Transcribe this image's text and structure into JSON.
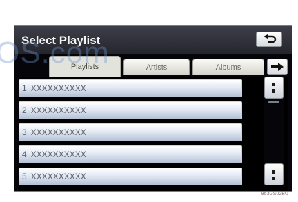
{
  "watermark": "OS.com",
  "header": {
    "title": "Select Playlist",
    "back_icon": "return-arrow-icon"
  },
  "tabs": [
    {
      "label": "Playlists",
      "active": true
    },
    {
      "label": "Artists",
      "active": false
    },
    {
      "label": "Albums",
      "active": false
    }
  ],
  "tab_next_icon": "right-arrow-icon",
  "playlists": [
    {
      "num": "1",
      "name": "XXXXXXXXXX"
    },
    {
      "num": "2",
      "name": "XXXXXXXXXX"
    },
    {
      "num": "3",
      "name": "XXXXXXXXXX"
    },
    {
      "num": "4",
      "name": "XXXXXXXXXX"
    },
    {
      "num": "5",
      "name": "XXXXXXXXXX"
    }
  ],
  "scroll_icons": [
    "scroll-up-icon",
    "scroll-down-icon"
  ],
  "image_code": "853GS02BU"
}
